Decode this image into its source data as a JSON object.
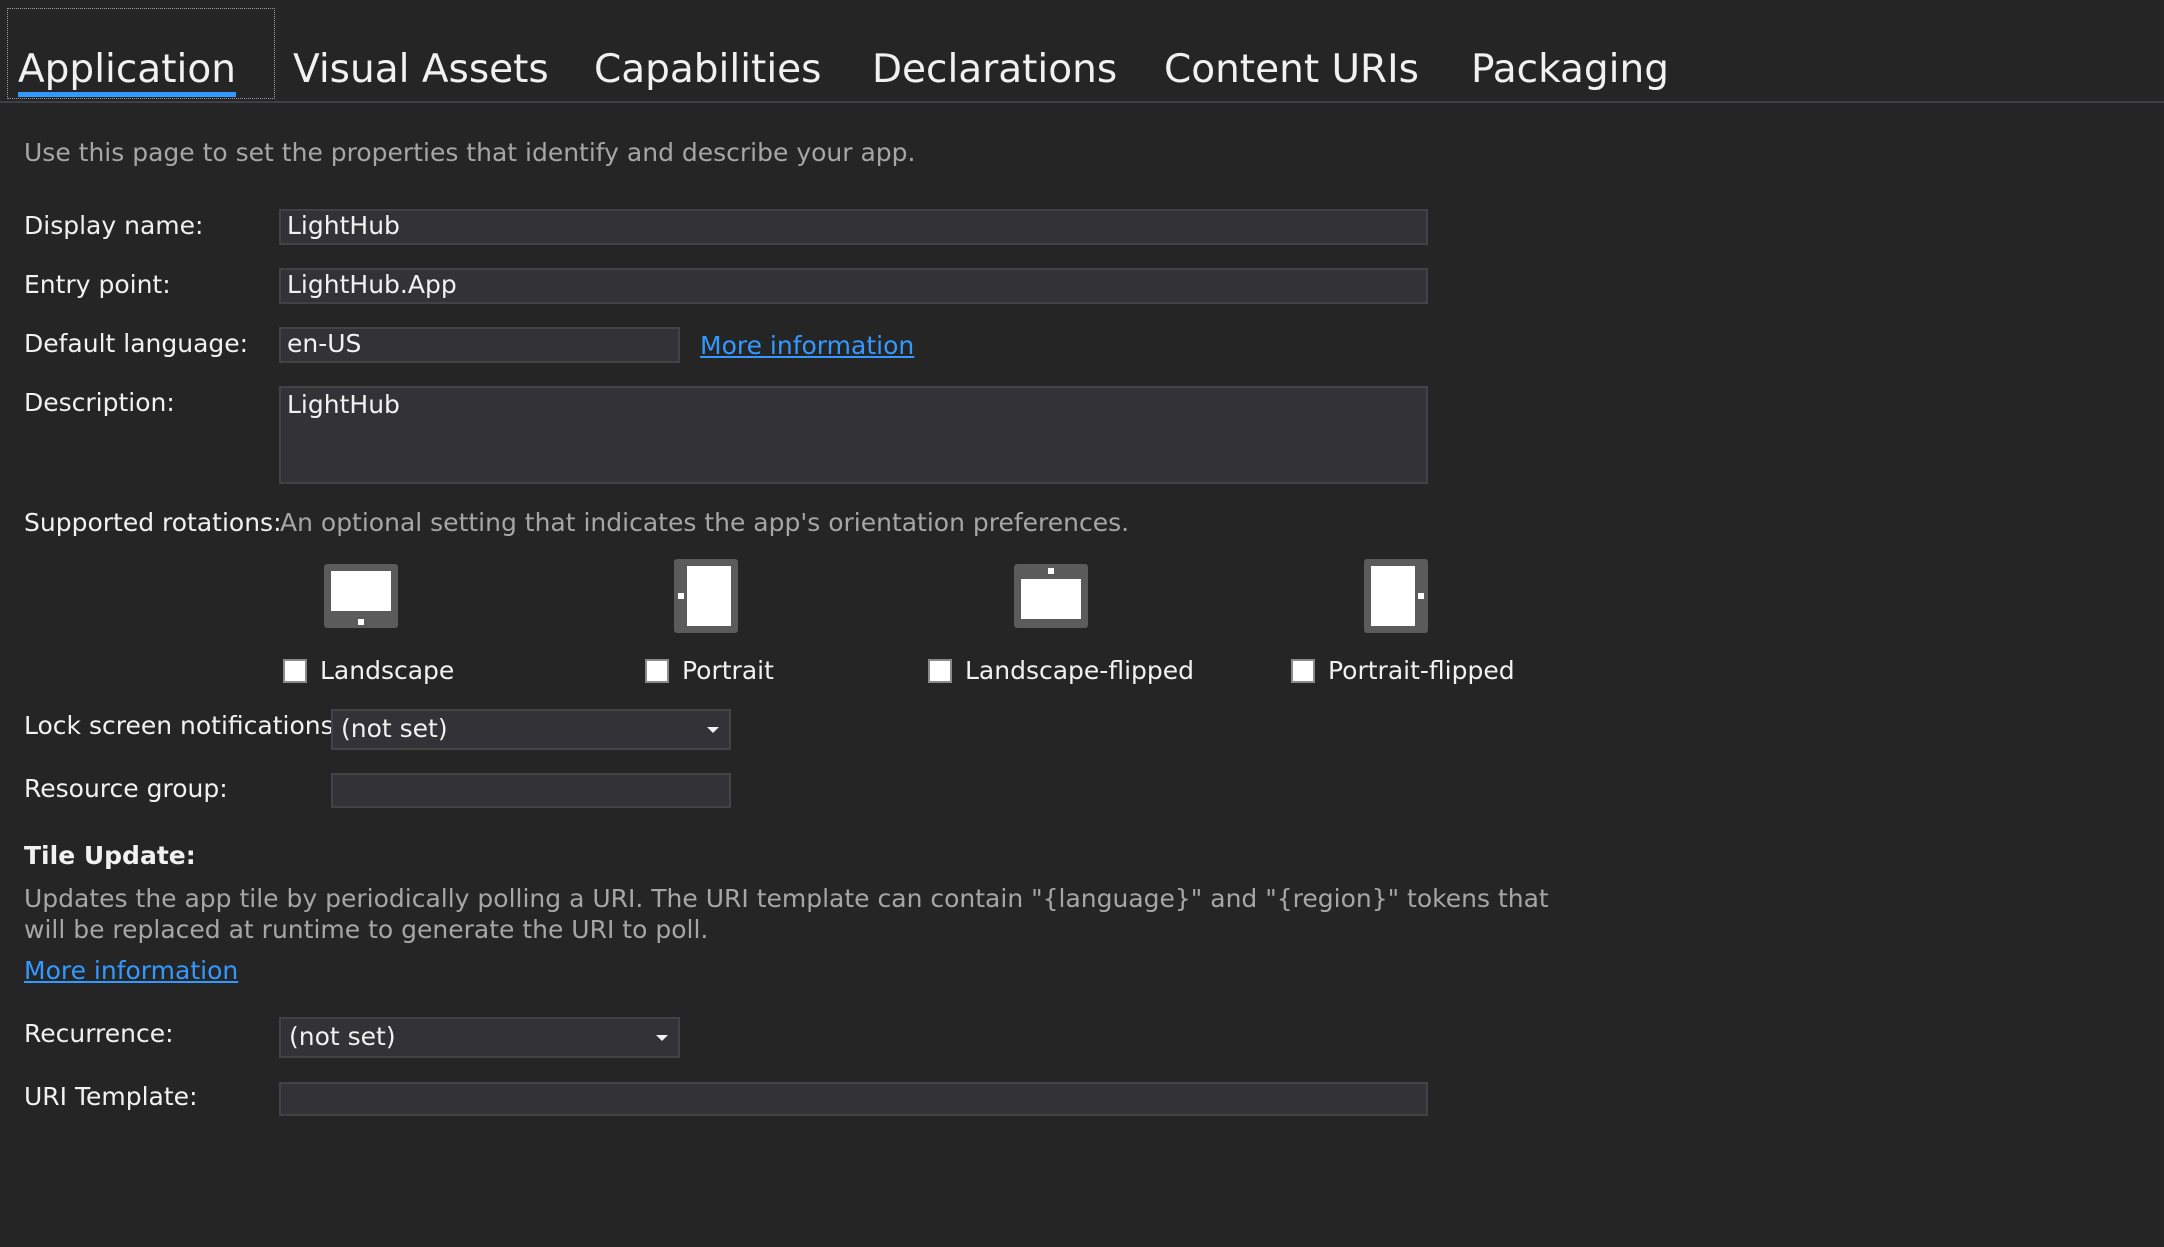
{
  "tabs": [
    {
      "label": "Application"
    },
    {
      "label": "Visual Assets"
    },
    {
      "label": "Capabilities"
    },
    {
      "label": "Declarations"
    },
    {
      "label": "Content URIs"
    },
    {
      "label": "Packaging"
    }
  ],
  "intro": "Use this page to set the properties that identify and describe your app.",
  "display_name": {
    "label": "Display name:",
    "value": "LightHub"
  },
  "entry_point": {
    "label": "Entry point:",
    "value": "LightHub.App"
  },
  "default_language": {
    "label": "Default language:",
    "value": "en-US",
    "link": "More information"
  },
  "description": {
    "label": "Description:",
    "value": "LightHub"
  },
  "rotations": {
    "label": "Supported rotations:",
    "hint": "An optional setting that indicates the app's orientation preferences.",
    "options": [
      {
        "label": "Landscape",
        "checked": false,
        "icon": "landscape-device-icon"
      },
      {
        "label": "Portrait",
        "checked": false,
        "icon": "portrait-device-icon"
      },
      {
        "label": "Landscape-flipped",
        "checked": false,
        "icon": "landscape-flipped-device-icon"
      },
      {
        "label": "Portrait-flipped",
        "checked": false,
        "icon": "portrait-flipped-device-icon"
      }
    ]
  },
  "lock_screen": {
    "label": "Lock screen notifications:",
    "value": "(not set)"
  },
  "resource_group": {
    "label": "Resource group:",
    "value": ""
  },
  "tile_update": {
    "heading": "Tile Update:",
    "description_line1": "Updates the app tile by periodically polling a URI. The URI template can contain \"{language}\" and \"{region}\" tokens that",
    "description_line2": "will be replaced at runtime to generate the URI to poll.",
    "link": "More information"
  },
  "recurrence": {
    "label": "Recurrence:",
    "value": "(not set)"
  },
  "uri_template": {
    "label": "URI Template:",
    "value": ""
  },
  "colors": {
    "background": "#252526",
    "accent": "#3399ff",
    "input_bg": "#333337",
    "muted_text": "#a6a6a6"
  }
}
